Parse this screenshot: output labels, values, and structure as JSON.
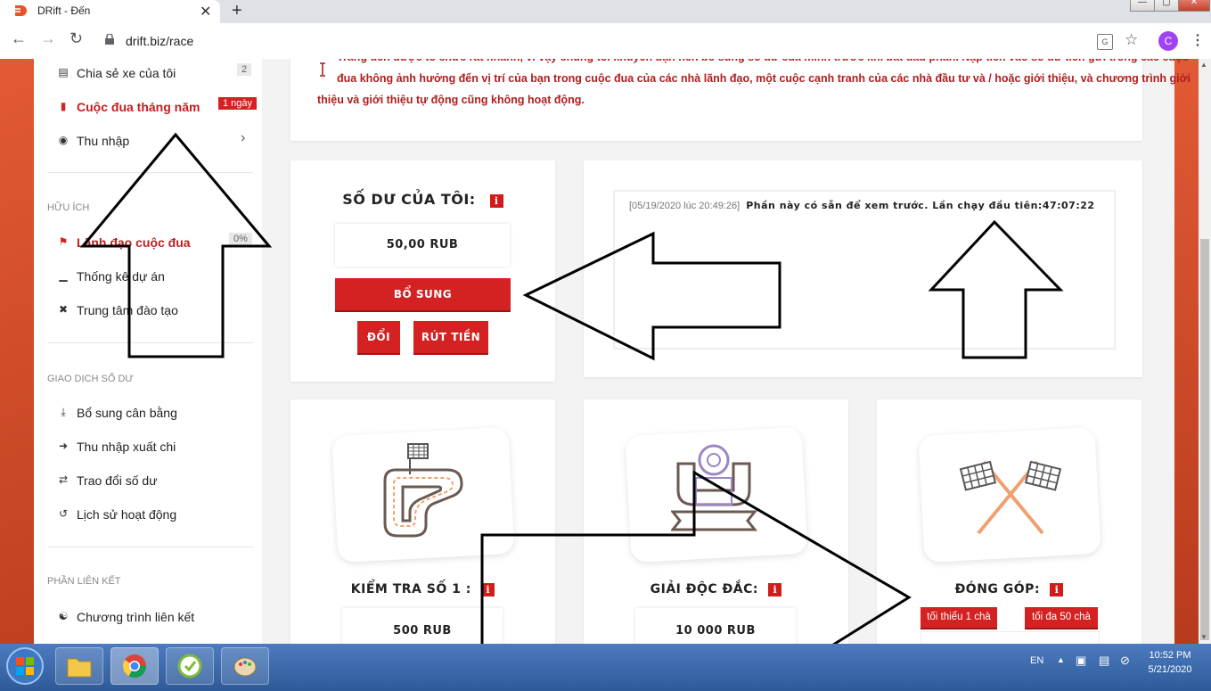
{
  "browser": {
    "tab_title": "DRift - Đến",
    "tab_close": "✕",
    "new_tab": "+",
    "url": "drift.biz/race",
    "avatar_letter": "C",
    "window_min": "—",
    "window_max": "▢",
    "window_close": "✕"
  },
  "sidebar": {
    "items_top": [
      {
        "label": "Chia sẻ xe của tôi",
        "icon": "car-share-icon",
        "badge": "2"
      },
      {
        "label": "Cuộc đua tháng năm",
        "icon": "wallet-icon",
        "badge": "1 ngày",
        "active": true
      },
      {
        "label": "Thu nhập",
        "icon": "money-bag-icon",
        "chevron": "›"
      }
    ],
    "section_useful": "HỮU ÍCH",
    "items_useful": [
      {
        "label": "Lãnh đạo cuộc đua",
        "icon": "flag-icon",
        "badge": "0%",
        "active": true
      },
      {
        "label": "Thống kê dự án",
        "icon": "chart-icon"
      },
      {
        "label": "Trung tâm đào tạo",
        "icon": "support-icon"
      }
    ],
    "section_balance": "GIAO DỊCH SỐ DƯ",
    "items_balance": [
      {
        "label": "Bổ sung cân bằng",
        "icon": "download-icon"
      },
      {
        "label": "Thu nhập xuất chi",
        "icon": "export-icon"
      },
      {
        "label": "Trao đổi số dư",
        "icon": "exchange-icon"
      },
      {
        "label": "Lịch sử hoạt động",
        "icon": "history-icon"
      }
    ],
    "section_affiliate": "PHẦN LIÊN KẾT",
    "items_affiliate": [
      {
        "label": "Chương trình liên kết",
        "icon": "handshake-icon"
      }
    ]
  },
  "notice": {
    "line1": "Trang đến được tổ chức rất nhanh, vì vậy chúng tôi khuyến bạn nên bổ sung số dư của mình trước khi bắt đầu phần. Nạp tiền vào số dư tiền gửi trong các cuộc",
    "line2": "đua không ảnh hưởng đến vị trí của bạn trong cuộc đua của các nhà lãnh đạo, một cuộc cạnh tranh của các nhà đầu tư và / hoặc giới thiệu, và chương trình giới",
    "line3": "thiệu và giới thiệu tự động cũng không hoạt động."
  },
  "balance": {
    "title": "SỐ DƯ CỦA TÔI:",
    "info": "i",
    "amount": "50,00 RUB",
    "topup_button": "BỔ SUNG",
    "exchange_button": "ĐỔI",
    "withdraw_button": "RÚT TIỀN"
  },
  "log": {
    "timestamp": "[05/19/2020 lúc 20:49:26]",
    "message": "Phần này có sẵn để xem trước. Lần chạy đầu tiên:47:07:22"
  },
  "tiles": [
    {
      "title": "KIỂM TRA SỐ 1 :",
      "info": "i",
      "value": "500 RUB",
      "icon": "race-track-icon"
    },
    {
      "title": "GIẢI ĐỘC ĐẮC:",
      "info": "i",
      "value": "10 000 RUB",
      "icon": "trophy-icon"
    },
    {
      "title": "ĐÓNG GÓP:",
      "info": "i",
      "min_button": "tối thiểu 1 chà",
      "max_button": "tối đa 50 chà",
      "icon": "checkered-flags-icon"
    }
  ],
  "taskbar": {
    "lang": "EN",
    "time": "10:52 PM",
    "date": "5/21/2020"
  },
  "colors": {
    "accent_red": "#d42121",
    "taskbar_blue": "#3a66a8",
    "avatar_purple": "#a142f4"
  }
}
